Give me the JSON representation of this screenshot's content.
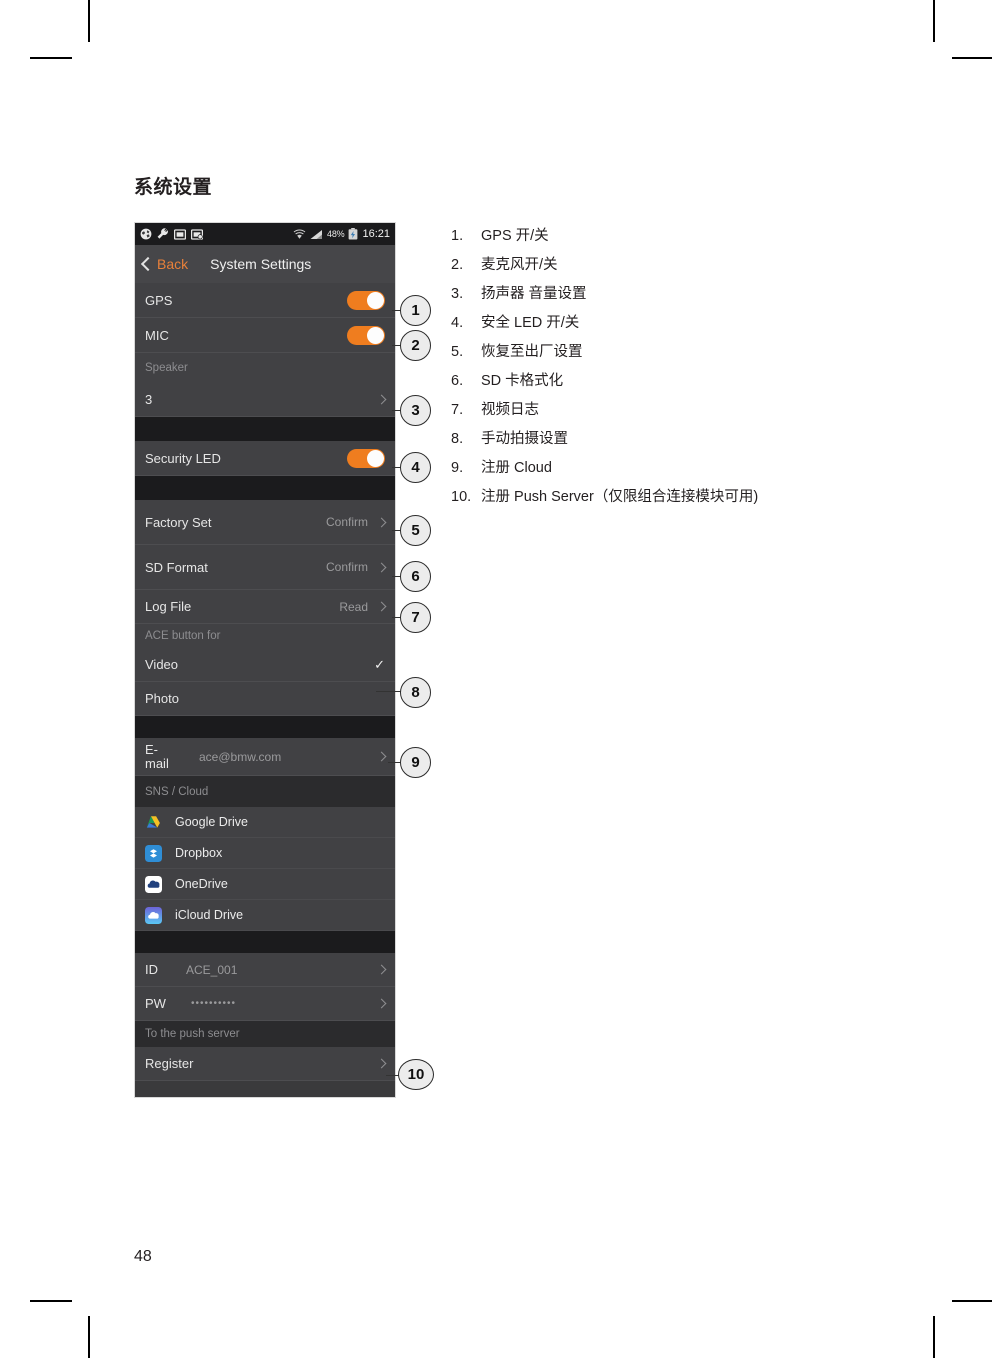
{
  "document": {
    "heading": "系统设置",
    "page_number": "48"
  },
  "phone": {
    "status_bar": {
      "icons": [
        "globe-icon",
        "wrench-icon",
        "image-icon",
        "image-badge-icon"
      ],
      "wifi": "wifi-icon",
      "signal": "signal-icon",
      "battery_percent": "48%",
      "battery": "battery-icon",
      "time": "16:21"
    },
    "nav": {
      "back_label": "Back",
      "title": "System Settings"
    },
    "rows": {
      "gps_label": "GPS",
      "mic_label": "MIC",
      "speaker_section": "Speaker",
      "speaker_value": "3",
      "security_led_label": "Security LED",
      "factory_set_label": "Factory Set",
      "factory_set_value": "Confirm",
      "sd_format_label": "SD Format",
      "sd_format_value": "Confirm",
      "log_file_label": "Log File",
      "log_file_value": "Read",
      "ace_section": "ACE button for",
      "video_label": "Video",
      "photo_label": "Photo",
      "email_label": "E-mail",
      "email_value": "ace@bmw.com",
      "sns_section": "SNS / Cloud",
      "id_label": "ID",
      "id_value": "ACE_001",
      "pw_label": "PW",
      "pw_value": "••••••••••",
      "push_section": "To the push server",
      "register_label": "Register"
    },
    "cloud_services": [
      {
        "name": "Google Drive",
        "icon": "google-drive-icon"
      },
      {
        "name": "Dropbox",
        "icon": "dropbox-icon"
      },
      {
        "name": "OneDrive",
        "icon": "onedrive-icon"
      },
      {
        "name": "iCloud Drive",
        "icon": "icloud-drive-icon"
      }
    ],
    "colors": {
      "accent": "#ef7d1f",
      "back_link": "#e8803a",
      "row_bg": "#414144",
      "band_bg": "#1b1b1d"
    }
  },
  "callouts": [
    "1",
    "2",
    "3",
    "4",
    "5",
    "6",
    "7",
    "8",
    "9",
    "10"
  ],
  "notes": [
    {
      "num": "1.",
      "text": "GPS 开/关"
    },
    {
      "num": "2.",
      "text": "麦克风开/关"
    },
    {
      "num": "3.",
      "text": "扬声器 音量设置"
    },
    {
      "num": "4.",
      "text": "安全 LED 开/关"
    },
    {
      "num": "5.",
      "text": "恢复至出厂设置"
    },
    {
      "num": "6.",
      "text": "SD 卡格式化"
    },
    {
      "num": "7.",
      "text": "视频日志"
    },
    {
      "num": "8.",
      "text": "手动拍摄设置"
    },
    {
      "num": "9.",
      "text": "注册 Cloud"
    },
    {
      "num": "10.",
      "text": "注册 Push Server（仅限组合连接模块可用)"
    }
  ]
}
